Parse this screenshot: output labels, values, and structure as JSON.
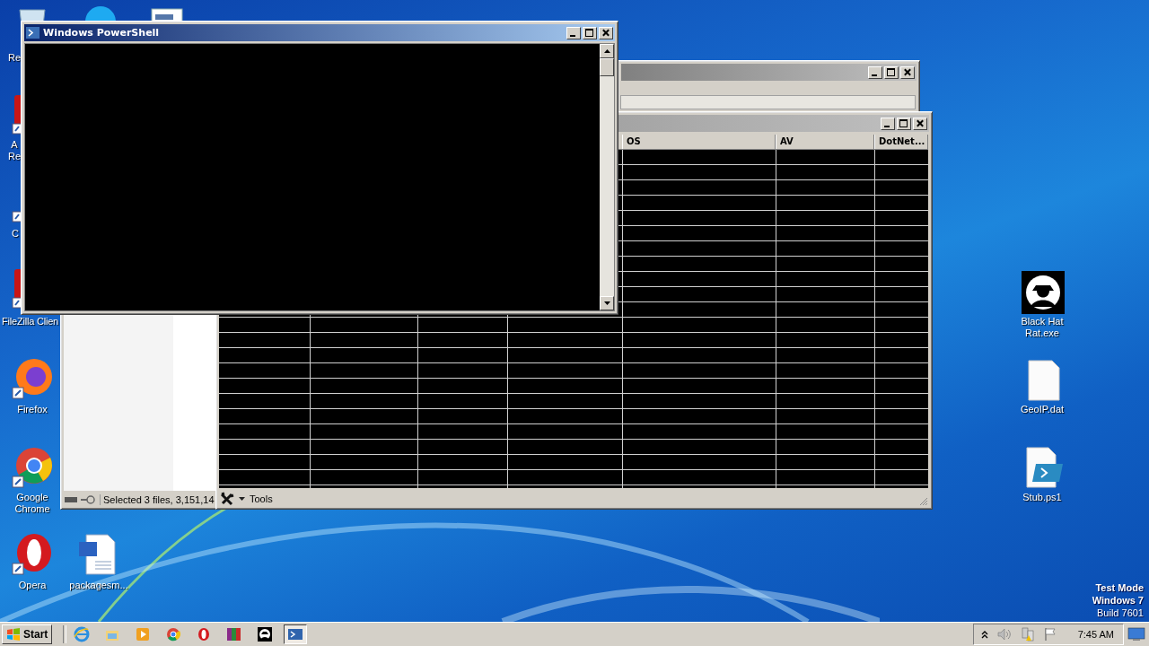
{
  "desktop_icons": [
    {
      "kind": "recycle-bin",
      "label": "Re"
    },
    {
      "kind": "skype"
    },
    {
      "kind": "document"
    },
    {
      "kind": "red-app",
      "label": "A Re"
    },
    {
      "kind": "shortcut",
      "label": "C"
    },
    {
      "kind": "red-app",
      "label": "FileZilla Clien"
    },
    {
      "kind": "firefox",
      "label": "Firefox"
    },
    {
      "kind": "chrome",
      "label": "Google Chrome"
    },
    {
      "kind": "opera",
      "label": "Opera"
    },
    {
      "kind": "word",
      "label": "packagesm..."
    },
    {
      "kind": "blackhat",
      "label": "Black Hat Rat.exe"
    },
    {
      "kind": "blank-file",
      "label": "GeoIP.dat"
    },
    {
      "kind": "ps1-file",
      "label": "Stub.ps1"
    }
  ],
  "system_text": [
    "Test Mode",
    "Windows 7",
    "Build 7601"
  ],
  "explorer_window": {
    "status_text": "Selected 3 files, 3,151,14"
  },
  "client_window": {
    "columns": [
      {
        "label": "OS"
      },
      {
        "label": "AV"
      },
      {
        "label": "DotNet..."
      }
    ],
    "tools_menu": "Tools"
  },
  "powershell_window": {
    "title": "Windows PowerShell"
  },
  "taskbar": {
    "start": "Start",
    "items": [
      {
        "kind": "ie",
        "selected": false
      },
      {
        "kind": "folder",
        "selected": false
      },
      {
        "kind": "media",
        "selected": false
      },
      {
        "kind": "chrome",
        "selected": false
      },
      {
        "kind": "opera",
        "selected": false
      },
      {
        "kind": "winrar",
        "selected": false
      },
      {
        "kind": "blackhat",
        "selected": false
      },
      {
        "kind": "powershell",
        "selected": true
      }
    ],
    "time": "7:45 AM"
  }
}
